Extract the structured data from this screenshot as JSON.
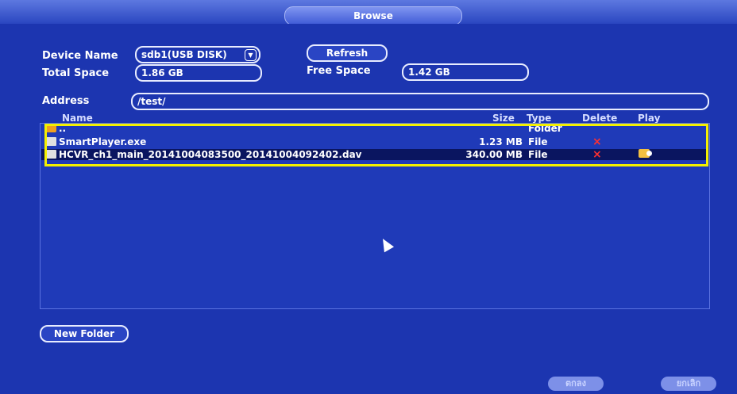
{
  "window": {
    "title": "Browse"
  },
  "fields": {
    "device_name_label": "Device Name",
    "device_name_value": "sdb1(USB DISK)",
    "refresh_label": "Refresh",
    "total_space_label": "Total Space",
    "total_space_value": "1.86 GB",
    "free_space_label": "Free Space",
    "free_space_value": "1.42 GB",
    "address_label": "Address",
    "address_value": "/test/"
  },
  "table": {
    "headers": {
      "name": "Name",
      "size": "Size",
      "type": "Type",
      "delete": "Delete",
      "play": "Play"
    },
    "rows": [
      {
        "name": "..",
        "size": "",
        "type": "Folder",
        "delete": "",
        "play": ""
      },
      {
        "name": "SmartPlayer.exe",
        "size": "1.23 MB",
        "type": "File",
        "delete": "×",
        "play": ""
      },
      {
        "name": "HCVR_ch1_main_20141004083500_20141004092402.dav",
        "size": "340.00 MB",
        "type": "File",
        "delete": "×",
        "play": "play-icon"
      }
    ]
  },
  "buttons": {
    "new_folder": "New Folder",
    "ok": "ตกลง",
    "cancel": "ยกเลิก"
  },
  "colors": {
    "background": "#1c35b0",
    "highlight": "#f4f000",
    "delete": "#ff3030"
  }
}
